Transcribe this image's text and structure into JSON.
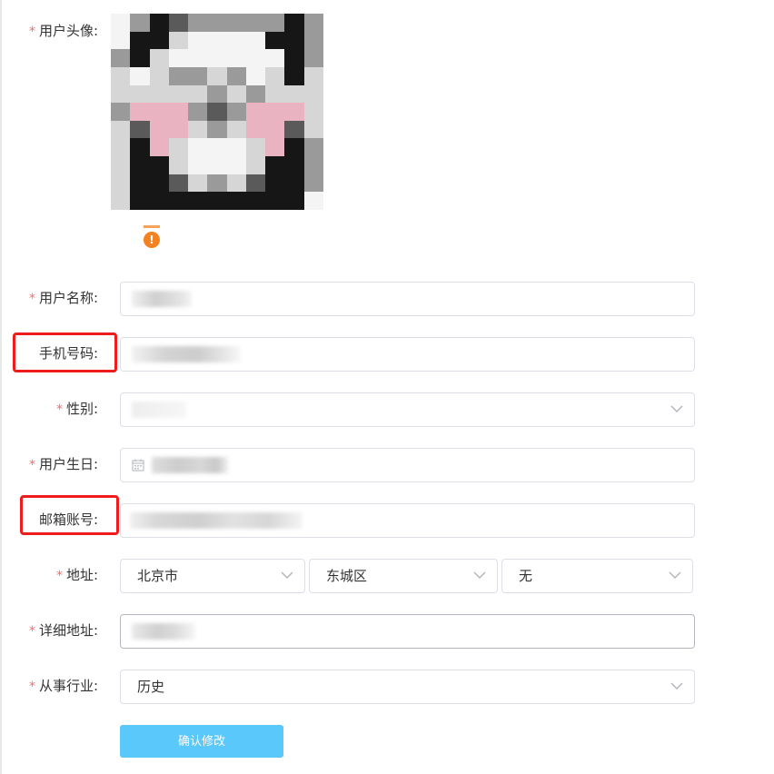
{
  "form": {
    "avatar": {
      "label": "用户头像:",
      "required": true,
      "status_icon": "warning-icon"
    },
    "username": {
      "label": "用户名称:",
      "required": true,
      "value_redacted": true
    },
    "phone": {
      "label": "手机号码:",
      "required": false,
      "value_redacted": true,
      "highlighted": true
    },
    "gender": {
      "label": "性别:",
      "required": true,
      "value_redacted": true
    },
    "birthday": {
      "label": "用户生日:",
      "required": true,
      "value_redacted": true,
      "icon": "calendar-icon"
    },
    "email": {
      "label": "邮箱账号:",
      "required": false,
      "value_redacted": true,
      "highlighted": true
    },
    "address": {
      "label": "地址:",
      "required": true,
      "province": "北京市",
      "district": "东城区",
      "street": "无"
    },
    "detail_address": {
      "label": "详细地址:",
      "required": true,
      "value_redacted": true
    },
    "industry": {
      "label": "从事行业:",
      "required": true,
      "value": "历史"
    },
    "submit_label": "确认修改"
  },
  "colors": {
    "required_star": "#f56c6c",
    "highlight_box": "#ee1c1c",
    "submit_button": "#5ac8fa",
    "warning_icon": "#f58220",
    "field_border": "#dcdfe6"
  }
}
